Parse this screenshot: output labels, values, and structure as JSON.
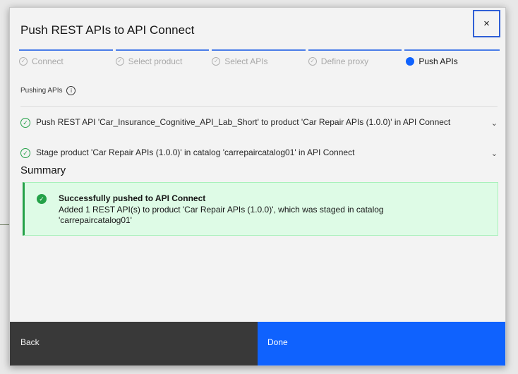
{
  "modal": {
    "title": "Push REST APIs to API Connect",
    "close_label": "×"
  },
  "steps": [
    {
      "label": "Connect",
      "state": "complete"
    },
    {
      "label": "Select product",
      "state": "complete"
    },
    {
      "label": "Select APIs",
      "state": "complete"
    },
    {
      "label": "Define proxy",
      "state": "complete"
    },
    {
      "label": "Push APIs",
      "state": "current"
    }
  ],
  "progress": {
    "heading": "Pushing APIs",
    "info_icon": "info-icon"
  },
  "tasks": [
    {
      "text": "Push REST API 'Car_Insurance_Cognitive_API_Lab_Short' to product 'Car Repair APIs (1.0.0)' in API Connect",
      "status": "success"
    },
    {
      "text": "Stage product 'Car Repair APIs (1.0.0)' in catalog 'carrepaircatalog01' in API Connect",
      "status": "success"
    }
  ],
  "summary": {
    "title": "Summary",
    "notification": {
      "title": "Successfully pushed to API Connect",
      "body": "Added 1 REST API(s) to product 'Car Repair APIs (1.0.0)', which was staged in catalog 'carrepaircatalog01'"
    }
  },
  "footer": {
    "back_label": "Back",
    "done_label": "Done"
  },
  "colors": {
    "primary": "#0f62fe",
    "success": "#24a148",
    "secondary_button": "#393939"
  }
}
